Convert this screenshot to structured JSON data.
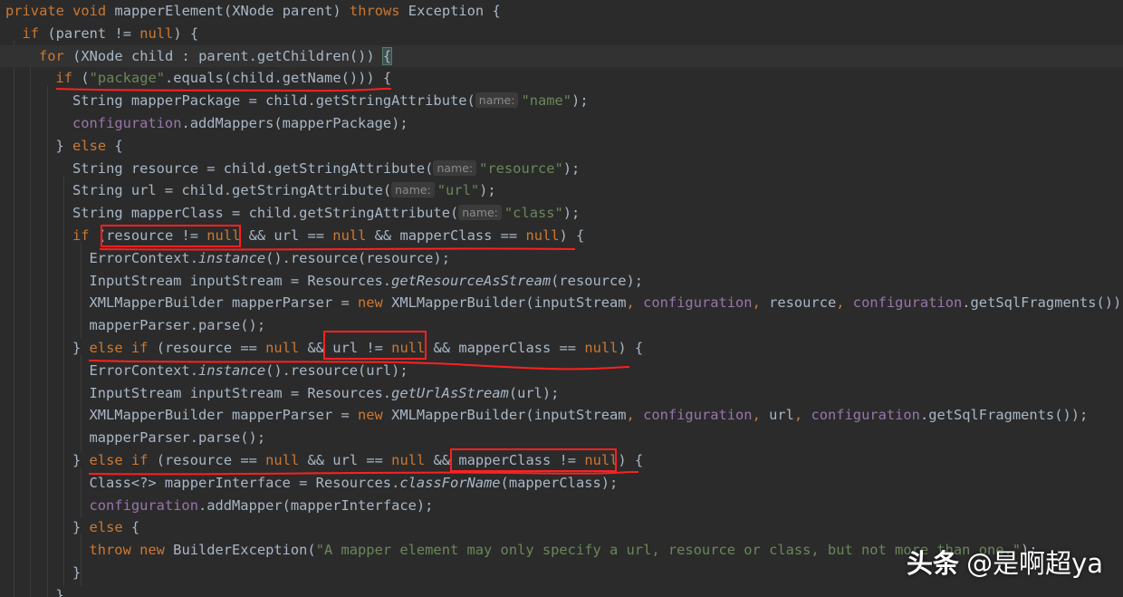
{
  "colors": {
    "background": "#2b2b2b",
    "keyword": "#cc7832",
    "string": "#6a8759",
    "field": "#9876aa",
    "default_text": "#a9b7c6",
    "hint_text": "#8a8a8a",
    "annotation_red": "#ff2020"
  },
  "code_lines": [
    {
      "indent": 0,
      "tokens": [
        {
          "t": "private void ",
          "c": "kw"
        },
        {
          "t": "mapperElement(XNode parent) "
        },
        {
          "t": "throws ",
          "c": "kw"
        },
        {
          "t": "Exception {"
        }
      ]
    },
    {
      "indent": 1,
      "tokens": [
        {
          "t": "if ",
          "c": "kw"
        },
        {
          "t": "(parent != "
        },
        {
          "t": "null",
          "c": "kw"
        },
        {
          "t": ") {"
        }
      ]
    },
    {
      "indent": 2,
      "highlight": true,
      "tokens": [
        {
          "t": "for ",
          "c": "kw"
        },
        {
          "t": "(XNode child : parent.getChildren()) "
        },
        {
          "t": "{",
          "c": "brace"
        }
      ]
    },
    {
      "indent": 3,
      "tokens": [
        {
          "t": "if ",
          "c": "kw"
        },
        {
          "t": "("
        },
        {
          "t": "\"package\"",
          "c": "str"
        },
        {
          "t": ".equals(child.getName())) {"
        }
      ]
    },
    {
      "indent": 4,
      "tokens": [
        {
          "t": "String mapperPackage = child.getStringAttribute("
        },
        {
          "t": "name:",
          "c": "hint"
        },
        {
          "t": "\"name\"",
          "c": "str"
        },
        {
          "t": ");"
        }
      ]
    },
    {
      "indent": 4,
      "tokens": [
        {
          "t": "configuration",
          "c": "fld"
        },
        {
          "t": ".addMappers(mapperPackage);"
        }
      ]
    },
    {
      "indent": 3,
      "tokens": [
        {
          "t": "} "
        },
        {
          "t": "else ",
          "c": "kw"
        },
        {
          "t": "{"
        }
      ]
    },
    {
      "indent": 4,
      "tokens": [
        {
          "t": "String resource = child.getStringAttribute("
        },
        {
          "t": "name:",
          "c": "hint"
        },
        {
          "t": "\"resource\"",
          "c": "str"
        },
        {
          "t": ");"
        }
      ]
    },
    {
      "indent": 4,
      "tokens": [
        {
          "t": "String url = child.getStringAttribute("
        },
        {
          "t": "name:",
          "c": "hint"
        },
        {
          "t": "\"url\"",
          "c": "str"
        },
        {
          "t": ");"
        }
      ]
    },
    {
      "indent": 4,
      "tokens": [
        {
          "t": "String mapperClass = child.getStringAttribute("
        },
        {
          "t": "name:",
          "c": "hint"
        },
        {
          "t": "\"class\"",
          "c": "str"
        },
        {
          "t": ");"
        }
      ]
    },
    {
      "indent": 4,
      "tokens": [
        {
          "t": "if ",
          "c": "kw"
        },
        {
          "t": "(resource != "
        },
        {
          "t": "null ",
          "c": "kw"
        },
        {
          "t": "&& url == "
        },
        {
          "t": "null ",
          "c": "kw"
        },
        {
          "t": "&& mapperClass == "
        },
        {
          "t": "null",
          "c": "kw"
        },
        {
          "t": ") {"
        }
      ]
    },
    {
      "indent": 5,
      "tokens": [
        {
          "t": "ErrorContext."
        },
        {
          "t": "instance",
          "c": "it"
        },
        {
          "t": "().resource(resource);"
        }
      ]
    },
    {
      "indent": 5,
      "tokens": [
        {
          "t": "InputStream inputStream = Resources."
        },
        {
          "t": "getResourceAsStream",
          "c": "it"
        },
        {
          "t": "(resource);"
        }
      ]
    },
    {
      "indent": 5,
      "tokens": [
        {
          "t": "XMLMapperBuilder mapperParser = "
        },
        {
          "t": "new ",
          "c": "kw"
        },
        {
          "t": "XMLMapperBuilder(inputStream"
        },
        {
          "t": ", ",
          "c": "kw"
        },
        {
          "t": "configuration",
          "c": "fld"
        },
        {
          "t": ", ",
          "c": "kw"
        },
        {
          "t": "resource"
        },
        {
          "t": ", ",
          "c": "kw"
        },
        {
          "t": "configuration",
          "c": "fld"
        },
        {
          "t": ".getSqlFragments());"
        }
      ]
    },
    {
      "indent": 5,
      "tokens": [
        {
          "t": "mapperParser.parse();"
        }
      ]
    },
    {
      "indent": 4,
      "tokens": [
        {
          "t": "} "
        },
        {
          "t": "else if ",
          "c": "kw"
        },
        {
          "t": "(resource == "
        },
        {
          "t": "null ",
          "c": "kw"
        },
        {
          "t": "&& url != "
        },
        {
          "t": "null ",
          "c": "kw"
        },
        {
          "t": "&& mapperClass == "
        },
        {
          "t": "null",
          "c": "kw"
        },
        {
          "t": ") {"
        }
      ]
    },
    {
      "indent": 5,
      "tokens": [
        {
          "t": "ErrorContext."
        },
        {
          "t": "instance",
          "c": "it"
        },
        {
          "t": "().resource(url);"
        }
      ]
    },
    {
      "indent": 5,
      "tokens": [
        {
          "t": "InputStream inputStream = Resources."
        },
        {
          "t": "getUrlAsStream",
          "c": "it"
        },
        {
          "t": "(url);"
        }
      ]
    },
    {
      "indent": 5,
      "tokens": [
        {
          "t": "XMLMapperBuilder mapperParser = "
        },
        {
          "t": "new ",
          "c": "kw"
        },
        {
          "t": "XMLMapperBuilder(inputStream"
        },
        {
          "t": ", ",
          "c": "kw"
        },
        {
          "t": "configuration",
          "c": "fld"
        },
        {
          "t": ", ",
          "c": "kw"
        },
        {
          "t": "url"
        },
        {
          "t": ", ",
          "c": "kw"
        },
        {
          "t": "configuration",
          "c": "fld"
        },
        {
          "t": ".getSqlFragments());"
        }
      ]
    },
    {
      "indent": 5,
      "tokens": [
        {
          "t": "mapperParser.parse();"
        }
      ]
    },
    {
      "indent": 4,
      "tokens": [
        {
          "t": "} "
        },
        {
          "t": "else if ",
          "c": "kw"
        },
        {
          "t": "(resource == "
        },
        {
          "t": "null ",
          "c": "kw"
        },
        {
          "t": "&& url == "
        },
        {
          "t": "null ",
          "c": "kw"
        },
        {
          "t": "&& mapperClass != "
        },
        {
          "t": "null",
          "c": "kw"
        },
        {
          "t": ") {"
        }
      ]
    },
    {
      "indent": 5,
      "tokens": [
        {
          "t": "Class<?> mapperInterface = Resources."
        },
        {
          "t": "classForName",
          "c": "it"
        },
        {
          "t": "(mapperClass);"
        }
      ]
    },
    {
      "indent": 5,
      "tokens": [
        {
          "t": "configuration",
          "c": "fld"
        },
        {
          "t": ".addMapper(mapperInterface);"
        }
      ]
    },
    {
      "indent": 4,
      "tokens": [
        {
          "t": "} "
        },
        {
          "t": "else ",
          "c": "kw"
        },
        {
          "t": "{"
        }
      ]
    },
    {
      "indent": 5,
      "tokens": [
        {
          "t": "throw new ",
          "c": "kw"
        },
        {
          "t": "BuilderException("
        },
        {
          "t": "\"A mapper element may only specify a url, resource or class, but not more than one.\"",
          "c": "str"
        },
        {
          "t": ");"
        }
      ]
    },
    {
      "indent": 4,
      "tokens": [
        {
          "t": "}"
        }
      ]
    },
    {
      "indent": 3,
      "tokens": [
        {
          "t": "}"
        }
      ]
    }
  ],
  "watermark": {
    "logo": "头条",
    "handle": "@是啊超ya"
  }
}
